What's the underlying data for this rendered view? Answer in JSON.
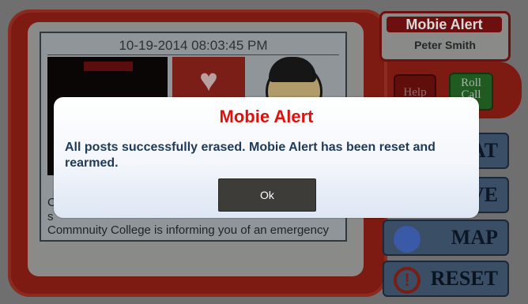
{
  "modal": {
    "title": "Mobie Alert",
    "message": "All posts successfully erased. Mobie Alert has been reset and rearmed.",
    "ok_label": "Ok"
  },
  "header": {
    "app_title": "Mobie Alert",
    "user_name": "Peter Smith"
  },
  "feed": {
    "timestamp": "10-19-2014 08:03:45 PM",
    "partial_line_1": "C",
    "partial_line_2": "s",
    "message_line": "Commnuity College is informing you of an emergency"
  },
  "buttons": {
    "help": "Help",
    "roll_call": "Roll Call",
    "chat_partial": "AT",
    "live_partial": "VE",
    "map": "MAP",
    "reset": "RESET"
  },
  "colors": {
    "modal_title": "#e0110c",
    "modal_text": "#1e3a57",
    "ok_button": "#3d3c38",
    "frame_red": "#7d1a12"
  },
  "icons": {
    "heart": "heart-pulse-icon",
    "globe": "globe-icon",
    "reset": "reset-icon"
  }
}
